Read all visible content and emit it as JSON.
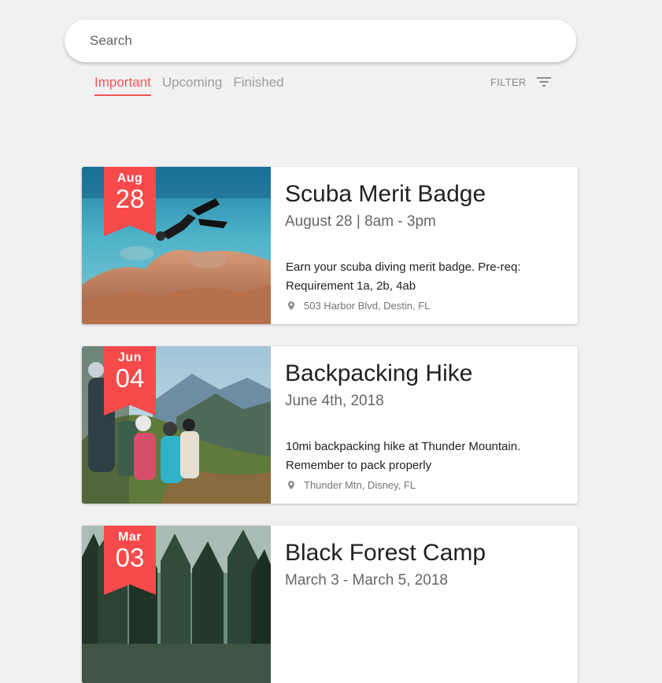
{
  "search": {
    "placeholder": "Search"
  },
  "tabs": [
    {
      "label": "Important",
      "active": true
    },
    {
      "label": "Upcoming",
      "active": false
    },
    {
      "label": "Finished",
      "active": false
    }
  ],
  "filter": {
    "label": "FILTER",
    "icon": "filter-list-icon"
  },
  "colors": {
    "accent": "#f0555a",
    "ribbon": "#f74a4a",
    "background": "#f1f1f1"
  },
  "events": [
    {
      "month": "Aug",
      "day": "28",
      "title": "Scuba Merit Badge",
      "date": "August 28 | 8am - 3pm",
      "description": "Earn your scuba diving merit badge. Pre-req: Requirement 1a, 2b, 4ab",
      "location": "503 Harbor Blvd, Destin, FL",
      "image": "scuba-diver-photo"
    },
    {
      "month": "Jun",
      "day": "04",
      "title": "Backpacking Hike",
      "date": "June 4th, 2018",
      "description": "10mi backpacking hike at Thunder Mountain. Remember to pack properly",
      "location": "Thunder Mtn, Disney, FL",
      "image": "hikers-mountain-photo"
    },
    {
      "month": "Mar",
      "day": "03",
      "title": "Black Forest Camp",
      "date": "March 3 - March 5, 2018",
      "image": "forest-photo"
    }
  ]
}
